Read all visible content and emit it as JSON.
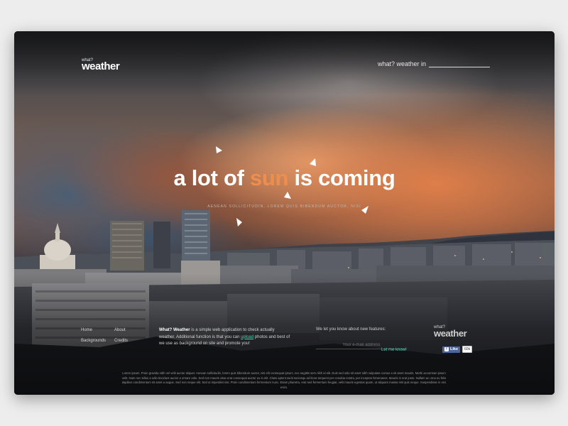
{
  "logo": {
    "small": "what?",
    "name": "weather"
  },
  "search": {
    "label": "what? weather in",
    "value": "",
    "placeholder": ""
  },
  "hero": {
    "title_before": "a lot of ",
    "title_highlight": "sun",
    "title_after": " is coming",
    "subtitle": "AENEAN SOLLICITUDIN, LOREM QUIS BIBENDUM AUCTOR, NISI"
  },
  "footer": {
    "nav": {
      "home": "Home",
      "about": "About",
      "backgrounds": "Backgrounds",
      "credits": "Credits"
    },
    "about": {
      "brand": "What? Weather",
      "text_1": " is a simple web application to check actually weather. Additional function is that you can ",
      "upload": "upload",
      "text_2": " photos and best of we use as background on site and promote you!"
    },
    "newsletter": {
      "label": "We let you know about new features:",
      "email_placeholder": "Your e-mail address",
      "submit": "Let me know!"
    },
    "logo": {
      "small": "what?",
      "name": "weather"
    },
    "facebook": {
      "like": "Like",
      "count": "60k"
    },
    "legal": "Lorem ipsum. Proin gravida nibh vel velit auctor aliquet. Aenean sollicitudin, lorem quis bibendum auctor, nisi elit consequat ipsum, nec sagittis sem nibh id elit. Duis sed odio sit amet nibh vulputate cursus a sit amet mauris. Morbi accumsan ipsum velit. Nam nec tellus a odio tincidunt auctor a ornare odio. Sed non mauris vitae erat consequat auctor eu in elit. Class aptent taciti sociosqu ad litora torquent per conubia nostra, per inceptos himenaeos. Mauris in erat justo. Nullam ac urna eu felis dapibus condimentum sit amet a augue. Sed non neque elit. Sed ut imperdiet nisi. Proin condimentum fermentum nunc. Etiam pharetra, erat sed fermentum feugiat, velit mauris egestas quam, ut aliquam massa nisl quis neque. Suspendisse in orci enim."
  },
  "colors": {
    "accent_orange": "#ee8e4e",
    "accent_teal": "#46d6b0",
    "facebook": "#4a66a0"
  }
}
